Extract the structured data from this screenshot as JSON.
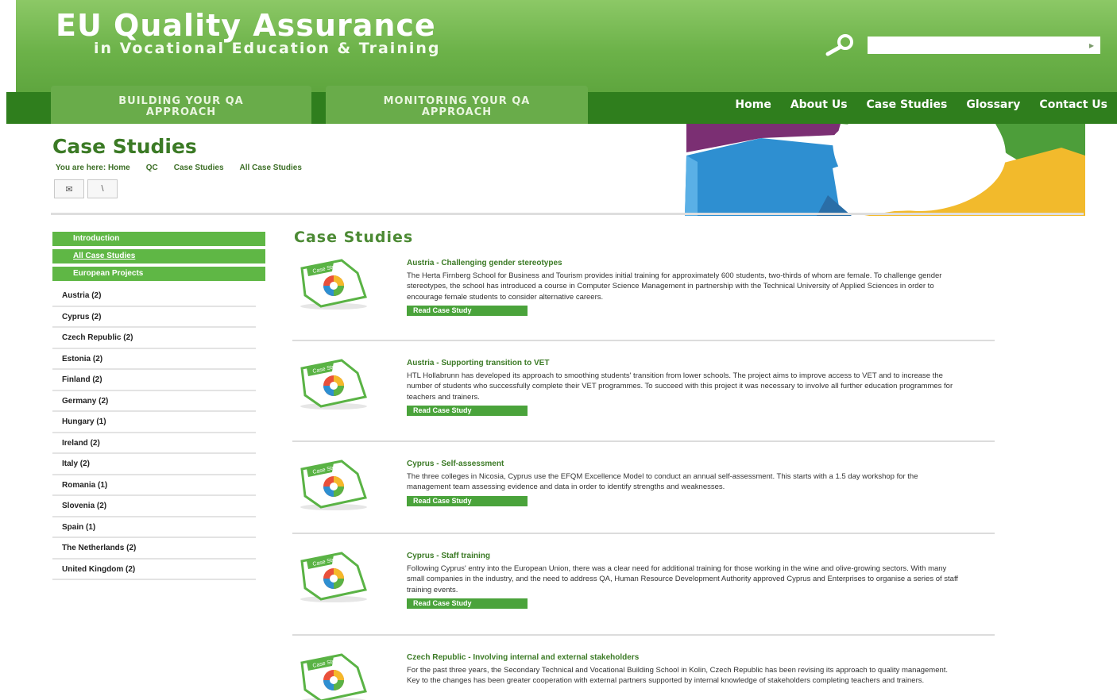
{
  "header": {
    "title": "EU Quality Assurance",
    "subtitle": "in Vocational Education & Training",
    "search": {
      "placeholder": "",
      "go_label": "▸"
    }
  },
  "nav": {
    "tabs": [
      {
        "line1": "BUILDING YOUR QA",
        "line2": "APPROACH"
      },
      {
        "line1": "MONITORING YOUR QA",
        "line2": "APPROACH"
      }
    ],
    "links": [
      "Home",
      "About Us",
      "Case Studies",
      "Glossary",
      "Contact Us"
    ]
  },
  "page": {
    "heading": "Case Studies",
    "breadcrumb": [
      "You are here: Home",
      "QC",
      "Case Studies",
      "All Case Studies"
    ],
    "tools": [
      "✉",
      "\\"
    ]
  },
  "sidebar": {
    "green_items": [
      "Introduction",
      "All Case Studies",
      "European Projects"
    ],
    "countries": [
      "Austria (2)",
      "Cyprus (2)",
      "Czech Republic (2)",
      "Estonia (2)",
      "Finland (2)",
      "Germany (2)",
      "Hungary (1)",
      "Ireland (2)",
      "Italy (2)",
      "Romania (1)",
      "Slovenia (2)",
      "Spain (1)",
      "The Netherlands (2)",
      "United Kingdom (2)"
    ]
  },
  "main": {
    "heading": "Case Studies",
    "read_label": "Read Case Study",
    "thumb_label": "Case Study",
    "cases": [
      {
        "title": "Austria - Challenging gender stereotypes",
        "desc": "The Herta Firnberg School for Business and Tourism provides initial training for approximately 600 students, two-thirds of whom are female. To challenge gender stereotypes, the school has introduced a course in Computer Science Management in partnership with the Technical University of Applied Sciences in order to encourage female students to consider alternative careers."
      },
      {
        "title": "Austria - Supporting transition to VET",
        "desc": "HTL Hollabrunn has developed its approach to smoothing students' transition from lower schools. The project aims to improve access to VET and to increase the number of students who successfully complete their VET programmes. To succeed with this project it was necessary to involve all further education programmes for teachers and trainers."
      },
      {
        "title": "Cyprus - Self-assessment",
        "desc": "The three colleges in Nicosia, Cyprus use the EFQM Excellence Model to conduct an annual self-assessment. This starts with a 1.5 day workshop for the management team assessing evidence and data in order to identify strengths and weaknesses."
      },
      {
        "title": "Cyprus - Staff training",
        "desc": "Following Cyprus' entry into the European Union, there was a clear need for additional training for those working in the wine and olive-growing sectors. With many small companies in the industry, and the need to address QA, Human Resource Development Authority approved Cyprus and Enterprises to organise a series of staff training events."
      },
      {
        "title": "Czech Republic - Involving internal and external stakeholders",
        "desc": "For the past three years, the Secondary Technical and Vocational Building School in Kolin, Czech Republic has been revising its approach to quality management. Key to the changes has been greater cooperation with external partners supported by internal knowledge of stakeholders completing teachers and trainers."
      }
    ]
  },
  "colors": {
    "header_green": "#6cb249",
    "nav_dark_green": "#2f7e1d",
    "accent_green": "#5fb745",
    "heading_green": "#3b7a25"
  }
}
